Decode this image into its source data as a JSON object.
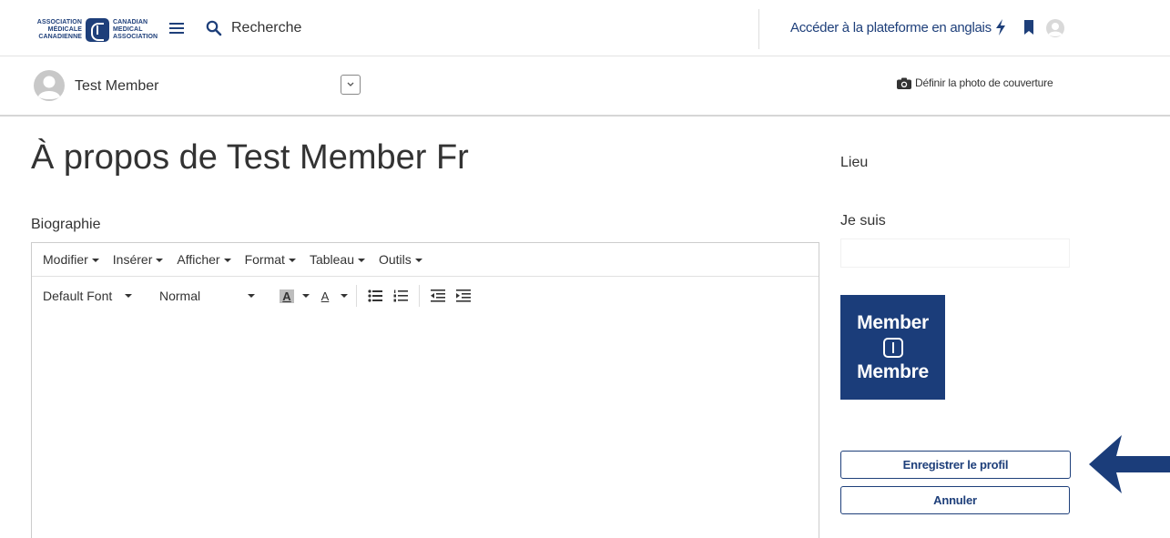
{
  "header": {
    "logo": {
      "left_lines": [
        "ASSOCIATION",
        "MÉDICALE",
        "CANADIENNE"
      ],
      "right_lines": [
        "CANADIAN",
        "MEDICAL",
        "ASSOCIATION"
      ]
    },
    "search_label": "Recherche",
    "access_link": "Accéder à la plateforme en anglais"
  },
  "profile_bar": {
    "name": "Test Member",
    "cover_photo_label": "Définir la photo de couverture"
  },
  "main": {
    "title": "À propos de Test Member Fr",
    "bio_label": "Biographie",
    "editor": {
      "menus": [
        "Modifier",
        "Insérer",
        "Afficher",
        "Format",
        "Tableau",
        "Outils"
      ],
      "font_family": "Default Font",
      "block_format": "Normal",
      "highlight_letter": "A",
      "text_color_letter": "A"
    }
  },
  "sidebar": {
    "location_label": "Lieu",
    "iam_label": "Je suis",
    "badge_top": "Member",
    "badge_bottom": "Membre",
    "save_label": "Enregistrer le profil",
    "cancel_label": "Annuler"
  },
  "colors": {
    "brand": "#1e3f7a",
    "badge": "#1b3d7a"
  }
}
